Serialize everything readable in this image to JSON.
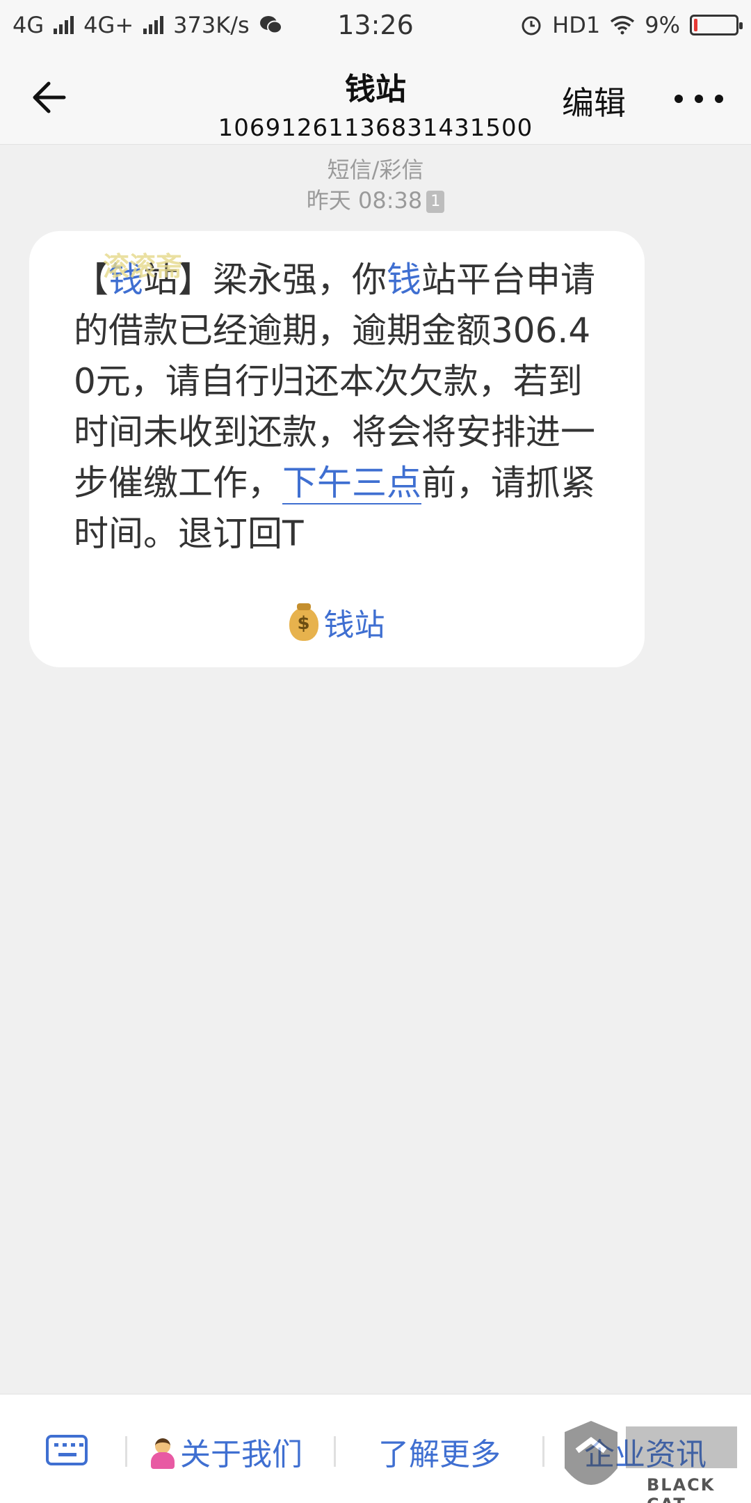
{
  "status_bar": {
    "network1": "4G",
    "network2": "4G+",
    "speed": "373K/s",
    "time": "13:26",
    "hd": "HD1",
    "battery": "9%",
    "battery_level": 0.09,
    "battery_color": "#e53935"
  },
  "header": {
    "title": "钱站",
    "number": "10691261136831431500",
    "edit_label": "编辑"
  },
  "meta": {
    "type": "短信/彩信",
    "time": "昨天 08:38",
    "sim": "1"
  },
  "message": {
    "watermark": "滚滚斋",
    "p1": "【",
    "p2": "钱",
    "p3": "站】梁永强，你",
    "p4": "钱",
    "p5": "站平台申请的借款已经逾期，逾期金额306.40元，请自行归还本次欠款，若到时间未收到还款，将会将安排进一步催缴工作，",
    "link": "下午三点",
    "p6": "前，请抓紧时间。退订回T",
    "signature": "钱站",
    "moneybag_symbol": "$"
  },
  "bottom_menu": {
    "item1": "关于我们",
    "item2": "了解更多",
    "item3": "企业资讯"
  },
  "watermark_logo": {
    "text": "BLACK CAT"
  },
  "colors": {
    "accent": "#3f6fd1",
    "background": "#f0f0f0",
    "bubble": "#ffffff"
  }
}
